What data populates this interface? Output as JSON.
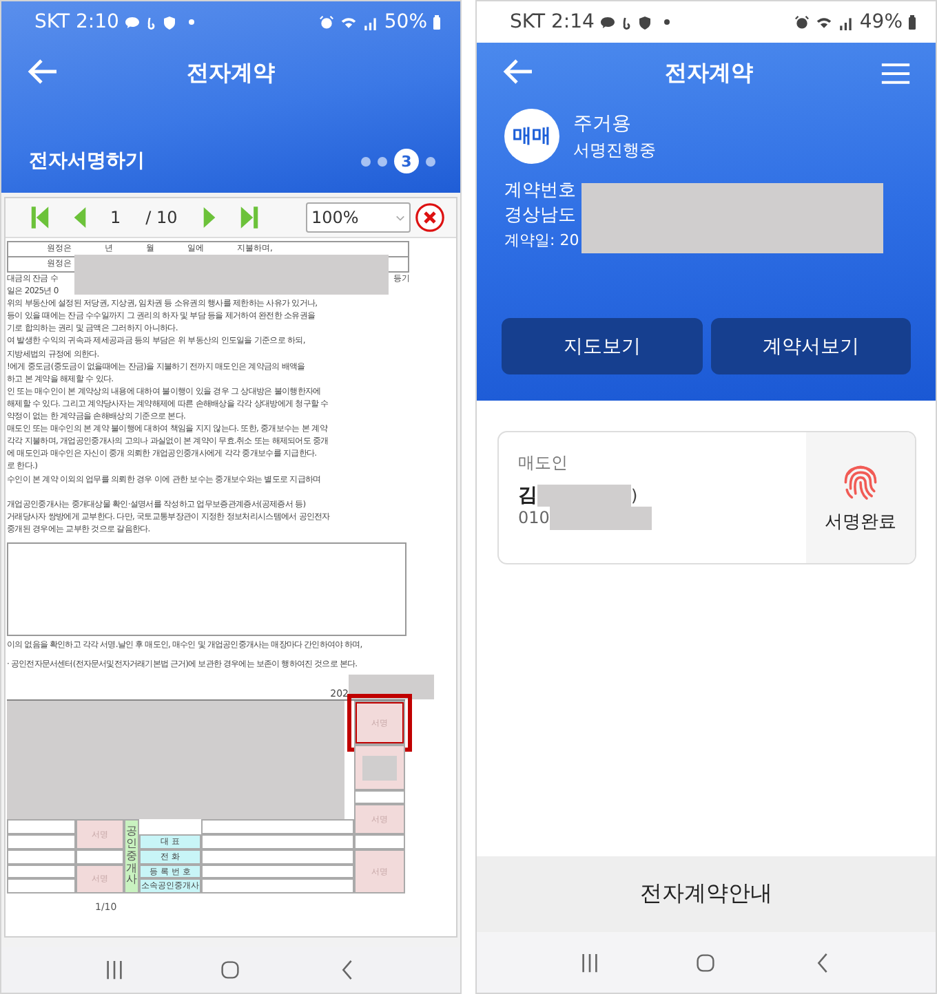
{
  "left_screen": {
    "status_bar": {
      "time": "SKT 2:10",
      "battery": "50%"
    },
    "header": {
      "title": "전자계약"
    },
    "step_title": "전자서명하기",
    "steps": [
      {
        "selected": false
      },
      {
        "selected": false
      },
      {
        "selected": true,
        "label": "3"
      },
      {
        "selected": false
      }
    ],
    "viewer": {
      "page": "1",
      "total": "/ 10",
      "zoom": "100%"
    },
    "document": {
      "payment_rows": [
        [
          "원정은",
          "년",
          "월",
          "일에",
          "지불하며,"
        ],
        [
          "원정은"
        ]
      ],
      "clauses": [
        [
          {
            "text": "대금의 잔금 수",
            "end": "등기"
          },
          {
            "text": "일은 2025년 0"
          },
          {
            "text": "위의 부동산에 설정된 저당권, 지상권, 임차권 등 소유권의 행사를 제한하는 사유가 있거나,"
          },
          {
            "text": "등이 있을 때에는 잔금 수수일까지 그 권리의 하자 및 부담 등을 제거하여 완전한 소유권을"
          },
          {
            "text": "기로 합의하는 권리 및 금액은 그러하지 아니하다."
          },
          {
            "text": "여 발생한 수익의 귀속과 제세공과금 등의 부담은 위 부동산의 인도일을 기준으로 하되,"
          },
          {
            "text": "지방세법의 규정에 의한다."
          },
          {
            "text": "!에게 중도금(중도금이 없을때에는 잔금)을 지불하기 전까지 매도인은 계약금의 배액을"
          },
          {
            "text": "하고 본 계약을 해제할 수 있다."
          },
          {
            "text": "인 또는 매수인이 본 계약상의 내용에 대하여 불이행이 있을 경우 그 상대방은 불이행한자에"
          },
          {
            "text": "해제할 수 있다. 그리고 계약당사자는 계약해제에 따른 손해배상을 각각 상대방에게 청구할 수"
          },
          {
            "text": "약정이 없는 한 계약금을 손해배상의 기준으로 본다."
          },
          {
            "text": "매도인 또는 매수인의 본 계약 불이행에 대하여 책임을 지지 않는다. 또한, 중개보수는 본 계약"
          },
          {
            "text": "각각 지불하며, 개업공인중개사의 고의나 과실없이 본 계약이 무효.취소 또는 해제되어도 중개"
          },
          {
            "text": "에 매도인과 매수인은 자신이 중개 의뢰한 개업공인중개사에게 각각 중개보수를 지급한다."
          },
          {
            "text": "로 한다.)"
          },
          {
            "text": "수인이 본 계약 이외의 업무를 의뢰한 경우 이에 관한 보수는 중개보수와는 별도로 지급하며"
          }
        ],
        [
          {
            "text": "개업공인중개사는 중개대상물 확인·설명서를 작성하고 업무보증관계증서(공제증서 등)"
          },
          {
            "text": "거래당사자 쌍방에게 교부한다. 다만, 국토교통부장관이 지정한 정보처리시스템에서 공인전자"
          },
          {
            "text": "중개된 경우에는 교부한 것으로 갈음한다."
          }
        ]
      ],
      "closing": [
        "이의 없음을 확인하고 각각 서명.날인 후 매도인, 매수인 및 개업공인중개사는 매장마다 간인하여야 하며,",
        "· 공인전자문서센터(전자문서및전자거래기본법 근거)에 보관한 경우에는 보존이 행하여진 것으로 본다."
      ],
      "date": "202",
      "sign_table": {
        "agent_label": "공인중개사",
        "agent_fields": [
          "대 표",
          "전 화",
          "등 록 번 호",
          "소속공인중개사"
        ],
        "right_signs": [
          {
            "label": "서명",
            "highlighted": true
          },
          {
            "highlighted": false
          },
          {
            "label": "서명",
            "highlighted": false
          },
          {
            "label": "서명",
            "highlighted": false
          }
        ],
        "left_signs": [
          {
            "label": "서명"
          },
          {
            "label": "서명"
          }
        ]
      },
      "page_label": "1/10"
    }
  },
  "right_screen": {
    "status_bar": {
      "time": "SKT 2:14",
      "battery": "49%"
    },
    "header": {
      "title": "전자계약"
    },
    "contract": {
      "badge": "매매",
      "usage": "주거용",
      "status": "서명진행중",
      "lines": [
        "계약번호",
        "경상남도 ",
        "계약일: 20"
      ]
    },
    "buttons": [
      "지도보기",
      "계약서보기"
    ],
    "seller": {
      "role": "매도인",
      "name": "김",
      "name_tail": ")",
      "phone": "010",
      "sign_status": "서명완료"
    },
    "guide_button": "전자계약안내"
  }
}
